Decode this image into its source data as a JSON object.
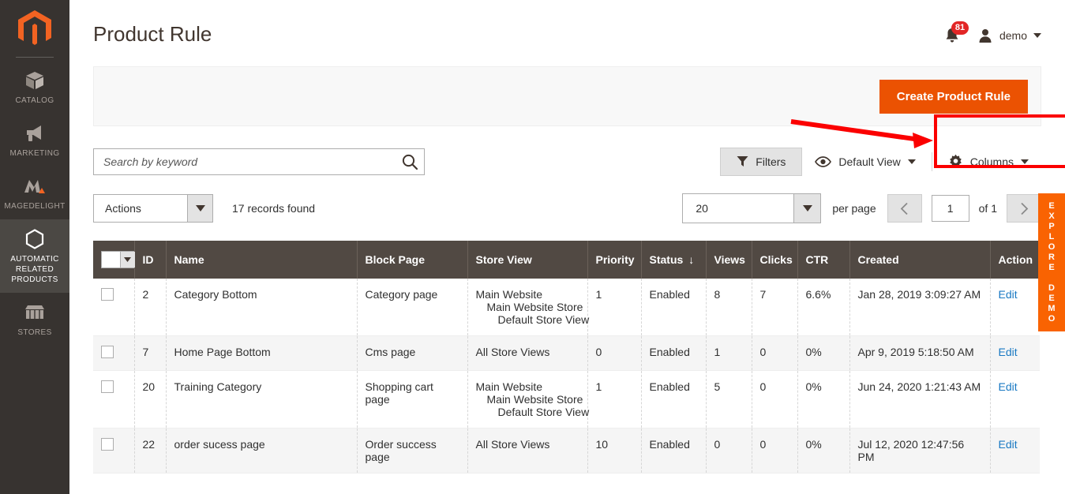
{
  "sidebar": {
    "logo": "magento-logo-icon",
    "items": [
      {
        "label": "CATALOG",
        "icon": "box-icon",
        "active": false
      },
      {
        "label": "MARKETING",
        "icon": "megaphone-icon",
        "active": false
      },
      {
        "label": "MAGEDELIGHT",
        "icon": "magedelight-icon",
        "active": false
      },
      {
        "label": "AUTOMATIC RELATED PRODUCTS",
        "icon": "hexagon-icon",
        "active": true
      },
      {
        "label": "STORES",
        "icon": "store-icon",
        "active": false
      }
    ]
  },
  "header": {
    "title": "Product Rule",
    "notifications_count": "81",
    "user_name": "demo"
  },
  "page_actions": {
    "create_button": "Create Product Rule"
  },
  "toolbar": {
    "search_placeholder": "Search by keyword",
    "search_value": "",
    "filters_label": "Filters",
    "view_label": "Default View",
    "columns_label": "Columns"
  },
  "subtoolbar": {
    "actions_label": "Actions",
    "records_found": "17 records found",
    "per_page_value": "20",
    "per_page_label": "per page",
    "page_value": "1",
    "page_of": "of 1"
  },
  "grid": {
    "columns": [
      "ID",
      "Name",
      "Block Page",
      "Store View",
      "Priority",
      "Status",
      "Views",
      "Clicks",
      "CTR",
      "Created",
      "Action"
    ],
    "sorted_column": "Status",
    "sort_direction": "↓",
    "rows": [
      {
        "id": "2",
        "name": "Category Bottom",
        "block_page": "Category page",
        "store_view": [
          "Main Website",
          "Main Website Store",
          "Default Store View"
        ],
        "priority": "1",
        "status": "Enabled",
        "views": "8",
        "clicks": "7",
        "ctr": "6.6%",
        "created": "Jan 28, 2019 3:09:27 AM",
        "action": "Edit"
      },
      {
        "id": "7",
        "name": "Home Page Bottom",
        "block_page": "Cms page",
        "store_view": [
          "All Store Views"
        ],
        "priority": "0",
        "status": "Enabled",
        "views": "1",
        "clicks": "0",
        "ctr": "0%",
        "created": "Apr 9, 2019 5:18:50 AM",
        "action": "Edit"
      },
      {
        "id": "20",
        "name": "Training Category",
        "block_page": "Shopping cart page",
        "store_view": [
          "Main Website",
          "Main Website Store",
          "Default Store View"
        ],
        "priority": "1",
        "status": "Enabled",
        "views": "5",
        "clicks": "0",
        "ctr": "0%",
        "created": "Jun 24, 2020 1:21:43 AM",
        "action": "Edit"
      },
      {
        "id": "22",
        "name": "order sucess page",
        "block_page": "Order success page",
        "store_view": [
          "All Store Views"
        ],
        "priority": "10",
        "status": "Enabled",
        "views": "0",
        "clicks": "0",
        "ctr": "0%",
        "created": "Jul 12, 2020 12:47:56 PM",
        "action": "Edit"
      }
    ]
  },
  "explore_demo": {
    "label": "EXPLORE DEMO"
  },
  "colors": {
    "brand_orange": "#eb5202",
    "sidebar_bg": "#373330",
    "table_header_bg": "#514943",
    "annotation_red": "#fb0000",
    "link_blue": "#1979c3",
    "badge_red": "#e22626",
    "explore_orange": "#f96302"
  }
}
